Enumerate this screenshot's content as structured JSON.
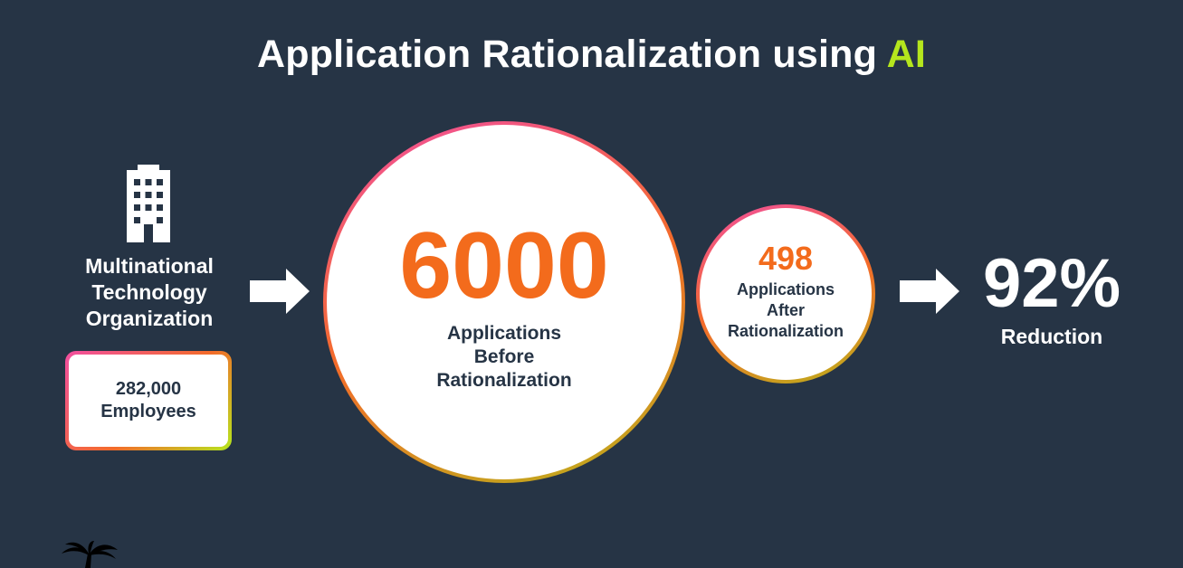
{
  "title": {
    "main": "Application Rationalization using ",
    "accent": "AI"
  },
  "organization": {
    "label_lines": [
      "Multinational",
      "Technology",
      "Organization"
    ],
    "employees_value": "282,000",
    "employees_label": "Employees"
  },
  "before": {
    "value": "6000",
    "caption_lines": [
      "Applications",
      "Before",
      "Rationalization"
    ]
  },
  "after": {
    "value": "498",
    "caption_lines": [
      "Applications",
      "After",
      "Rationalization"
    ]
  },
  "reduction": {
    "value": "92%",
    "label": "Reduction"
  },
  "icons": [
    "building-icon",
    "arrow-right-icon",
    "palm-tree-icon"
  ],
  "colors": {
    "background": "#263445",
    "accent_green": "#b5e61d",
    "number_orange": "#f36b1c",
    "ring_pink": "#f24fa1"
  }
}
